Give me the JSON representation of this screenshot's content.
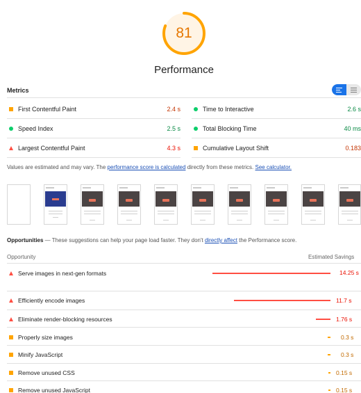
{
  "gauge": {
    "score": "81",
    "color": "#ffa400",
    "value": 0.81
  },
  "title": "Performance",
  "metrics": {
    "heading": "Metrics",
    "items": [
      {
        "label": "First Contentful Paint",
        "value": "2.4 s",
        "icon": "average-square-icon",
        "status": "average"
      },
      {
        "label": "Time to Interactive",
        "value": "2.6 s",
        "icon": "pass-circle-icon",
        "status": "pass"
      },
      {
        "label": "Speed Index",
        "value": "2.5 s",
        "icon": "pass-circle-icon",
        "status": "pass"
      },
      {
        "label": "Total Blocking Time",
        "value": "40 ms",
        "icon": "pass-circle-icon",
        "status": "pass"
      },
      {
        "label": "Largest Contentful Paint",
        "value": "4.3 s",
        "icon": "fail-triangle-icon",
        "status": "fail"
      },
      {
        "label": "Cumulative Layout Shift",
        "value": "0.183",
        "icon": "average-square-icon",
        "status": "average"
      }
    ]
  },
  "note": {
    "text1": "Values are estimated and may vary. The ",
    "link1": "performance score is calculated",
    "text2": " directly from these metrics. ",
    "link2": "See calculator."
  },
  "opportunities": {
    "heading": "Opportunities",
    "subtitle1": " — These suggestions can help your page load faster. They don't ",
    "link": "directly affect",
    "subtitle2": " the Performance score.",
    "col_left": "Opportunity",
    "col_right": "Estimated Savings",
    "items": [
      {
        "label": "Serve images in next-gen formats",
        "savings": "14.25 s",
        "status": "fail",
        "fraction": 1.0
      },
      {
        "label": "Efficiently encode images",
        "savings": "11.7 s",
        "status": "fail",
        "fraction": 0.82
      },
      {
        "label": "Eliminate render-blocking resources",
        "savings": "1.76 s",
        "status": "fail",
        "fraction": 0.12
      },
      {
        "label": "Properly size images",
        "savings": "0.3 s",
        "status": "average",
        "fraction": 0.02
      },
      {
        "label": "Minify JavaScript",
        "savings": "0.3 s",
        "status": "average",
        "fraction": 0.02
      },
      {
        "label": "Remove unused CSS",
        "savings": "0.15 s",
        "status": "average",
        "fraction": 0.01
      },
      {
        "label": "Remove unused JavaScript",
        "savings": "0.15 s",
        "status": "average",
        "fraction": 0.01
      }
    ]
  },
  "colors": {
    "pass": "#0cce6b",
    "average": "#ffa400",
    "fail": "#ff4e42"
  }
}
